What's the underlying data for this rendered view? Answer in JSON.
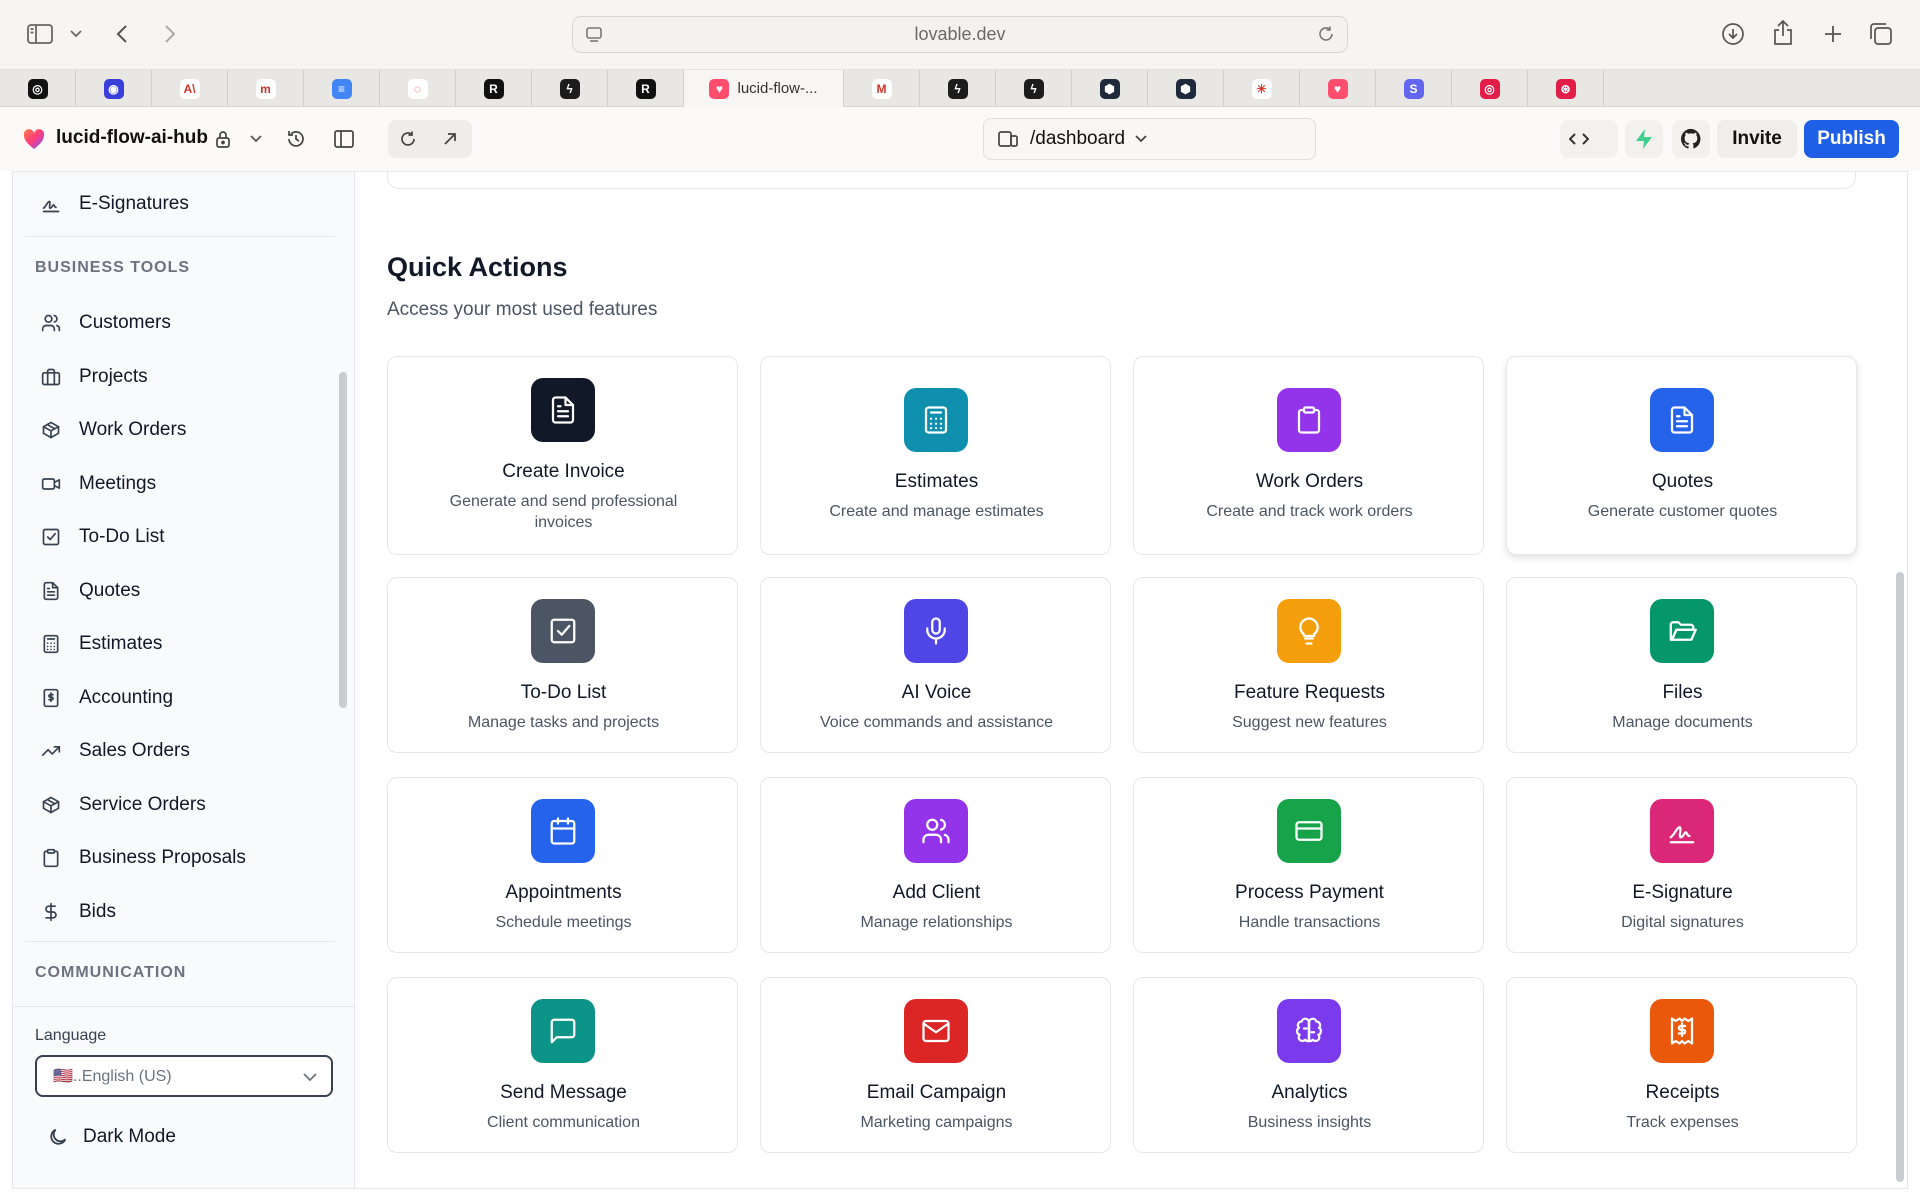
{
  "browser": {
    "url": "lovable.dev",
    "tabs": [
      {
        "favicon": "openai-icon",
        "color": "#111111",
        "glyph": "◎"
      },
      {
        "favicon": "target-icon",
        "color": "#3b3fd9",
        "glyph": "◉"
      },
      {
        "favicon": "anthropic-icon",
        "color": "#ffffff",
        "glyph": "A\\"
      },
      {
        "favicon": "m-icon",
        "color": "#ffffff",
        "glyph": "m"
      },
      {
        "favicon": "docs-icon",
        "color": "#4285f4",
        "glyph": "≡"
      },
      {
        "favicon": "swirl-icon",
        "color": "#ffffff",
        "glyph": "◌"
      },
      {
        "favicon": "r-icon",
        "color": "#111111",
        "glyph": "R"
      },
      {
        "favicon": "supabase-icon",
        "color": "#1c1c1c",
        "glyph": "ϟ"
      },
      {
        "favicon": "r-icon",
        "color": "#111111",
        "glyph": "R"
      },
      {
        "favicon": "lovable-icon",
        "color": "#ff4d6d",
        "glyph": "♥",
        "title": "lucid-flow-...",
        "active": true
      },
      {
        "favicon": "gmail-icon",
        "color": "#ffffff",
        "glyph": "M"
      },
      {
        "favicon": "supabase-icon",
        "color": "#1c1c1c",
        "glyph": "ϟ"
      },
      {
        "favicon": "supabase-icon",
        "color": "#1c1c1c",
        "glyph": "ϟ"
      },
      {
        "favicon": "hex-icon",
        "color": "#1e293b",
        "glyph": "⬢"
      },
      {
        "favicon": "hex-icon",
        "color": "#1e293b",
        "glyph": "⬢"
      },
      {
        "favicon": "claude-icon",
        "color": "#ffffff",
        "glyph": "✳"
      },
      {
        "favicon": "lovable-icon",
        "color": "#ff4d6d",
        "glyph": "♥"
      },
      {
        "favicon": "s-icon",
        "color": "#6366f1",
        "glyph": "S"
      },
      {
        "favicon": "circle-icon",
        "color": "#e11d48",
        "glyph": "◎"
      },
      {
        "favicon": "circle-icon",
        "color": "#e11d48",
        "glyph": "⊛"
      }
    ]
  },
  "toolbar": {
    "project_name": "lucid-flow-ai-hub",
    "route": "/dashboard",
    "invite_label": "Invite",
    "publish_label": "Publish"
  },
  "sidebar": {
    "top_item": "E-Signatures",
    "business_section_title": "BUSINESS TOOLS",
    "business_items": [
      {
        "label": "Customers",
        "icon": "users-icon"
      },
      {
        "label": "Projects",
        "icon": "briefcase-icon"
      },
      {
        "label": "Work Orders",
        "icon": "box-icon"
      },
      {
        "label": "Meetings",
        "icon": "video-icon"
      },
      {
        "label": "To-Do List",
        "icon": "checkbox-icon"
      },
      {
        "label": "Quotes",
        "icon": "file-text-icon"
      },
      {
        "label": "Estimates",
        "icon": "calculator-icon"
      },
      {
        "label": "Accounting",
        "icon": "dollar-receipt-icon"
      },
      {
        "label": "Sales Orders",
        "icon": "trending-up-icon"
      },
      {
        "label": "Service Orders",
        "icon": "box-icon"
      },
      {
        "label": "Business Proposals",
        "icon": "clipboard-icon"
      },
      {
        "label": "Bids",
        "icon": "dollar-icon"
      }
    ],
    "communication_section_title": "COMMUNICATION",
    "language_label": "Language",
    "language_value": "🇺🇸..English (US)",
    "dark_mode_label": "Dark Mode"
  },
  "main": {
    "title": "Quick Actions",
    "subtitle": "Access your most used features",
    "actions": [
      {
        "title": "Create Invoice",
        "desc": "Generate and send professional invoices",
        "color": "#111827",
        "icon": "file-text-icon"
      },
      {
        "title": "Estimates",
        "desc": "Create and manage estimates",
        "color": "#0e8fae",
        "icon": "calculator-icon"
      },
      {
        "title": "Work Orders",
        "desc": "Create and track work orders",
        "color": "#9333ea",
        "icon": "clipboard-icon"
      },
      {
        "title": "Quotes",
        "desc": "Generate customer quotes",
        "color": "#2563eb",
        "icon": "file-text-icon"
      },
      {
        "title": "To-Do List",
        "desc": "Manage tasks and projects",
        "color": "#4b5563",
        "icon": "checkbox-icon"
      },
      {
        "title": "AI Voice",
        "desc": "Voice commands and assistance",
        "color": "#4f46e5",
        "icon": "mic-icon"
      },
      {
        "title": "Feature Requests",
        "desc": "Suggest new features",
        "color": "#f59e0b",
        "icon": "lightbulb-icon"
      },
      {
        "title": "Files",
        "desc": "Manage documents",
        "color": "#059669",
        "icon": "folder-icon"
      },
      {
        "title": "Appointments",
        "desc": "Schedule meetings",
        "color": "#2563eb",
        "icon": "calendar-icon"
      },
      {
        "title": "Add Client",
        "desc": "Manage relationships",
        "color": "#9333ea",
        "icon": "users-icon"
      },
      {
        "title": "Process Payment",
        "desc": "Handle transactions",
        "color": "#16a34a",
        "icon": "credit-card-icon"
      },
      {
        "title": "E-Signature",
        "desc": "Digital signatures",
        "color": "#db2777",
        "icon": "signature-icon"
      },
      {
        "title": "Send Message",
        "desc": "Client communication",
        "color": "#0d9488",
        "icon": "message-icon"
      },
      {
        "title": "Email Campaign",
        "desc": "Marketing campaigns",
        "color": "#dc2626",
        "icon": "mail-icon"
      },
      {
        "title": "Analytics",
        "desc": "Business insights",
        "color": "#7c3aed",
        "icon": "brain-icon"
      },
      {
        "title": "Receipts",
        "desc": "Track expenses",
        "color": "#ea580c",
        "icon": "receipt-icon"
      }
    ]
  }
}
